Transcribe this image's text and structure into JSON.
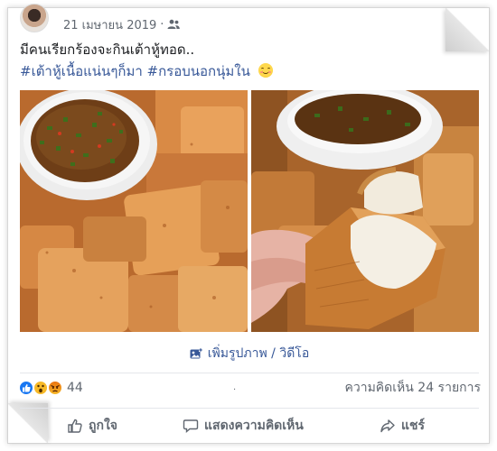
{
  "post": {
    "timestamp": "21 เมษายน 2019",
    "separator": "·",
    "privacy_icon": "friends-icon",
    "text": "มีคนเรียกร้องจะกินเต้าหู้ทอด..",
    "hashtags": "#เต้าหู้เนื้อแน่นๆก็มา #กรอบนอกนุ่มใน",
    "emoji": "smiling-face-emoji"
  },
  "photos": [
    {
      "subject": "fried-tofu-with-dipping-sauce"
    },
    {
      "subject": "fried-tofu-held-bitten"
    }
  ],
  "add_photo": {
    "icon": "add-photo-icon",
    "label": "เพิ่มรูปภาพ / วิดีโอ"
  },
  "reactions": {
    "icons": [
      "like-reaction-icon",
      "wow-reaction-icon",
      "angry-reaction-icon"
    ],
    "count": "44",
    "mid_dot": ".",
    "comments": "ความคิดเห็น 24 รายการ"
  },
  "actions": {
    "like": "ถูกใจ",
    "comment": "แสดงความคิดเห็น",
    "share": "แชร์"
  },
  "colors": {
    "link": "#385898",
    "meta": "#606770",
    "like_blue": "#1877f2"
  }
}
